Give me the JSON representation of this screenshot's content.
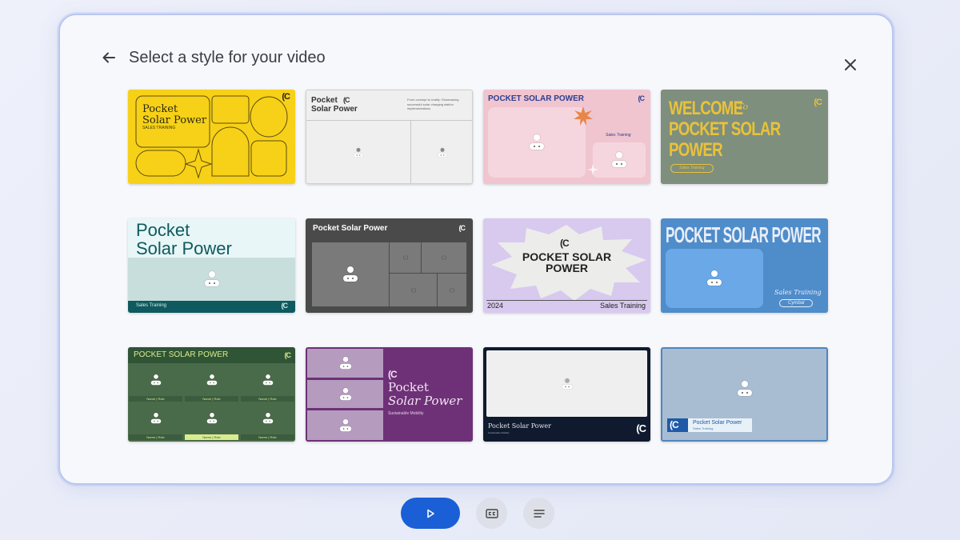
{
  "dialog": {
    "title": "Select a style for your video"
  },
  "logo": "(C",
  "cards": {
    "c1": {
      "title": "Pocket\nSolar Power",
      "subtitle": "SALES TRAINING"
    },
    "c2": {
      "title": "Pocket\nSolar Power",
      "tagline": "From concept to reality: Showcasing successful solar charging station implementations"
    },
    "c3": {
      "title": "POCKET SOLAR POWER",
      "subtitle": "Sales Training"
    },
    "c4": {
      "line1": "WELCOME",
      "to": "To",
      "line2": "POCKET SOLAR",
      "line3": "POWER",
      "subtitle": "Sales Training"
    },
    "c5": {
      "title": "Pocket\nSolar Power",
      "footer": "Sales Training"
    },
    "c6": {
      "title": "Pocket Solar Power"
    },
    "c7": {
      "title": "POCKET SOLAR\nPOWER",
      "year": "2024",
      "footer": "Sales Training"
    },
    "c8": {
      "title": "POCKET SOLAR POWER",
      "subtitle": "Sales Training",
      "badge": "Cymbal"
    },
    "c9": {
      "title": "POCKET SOLAR POWER",
      "name_label": "Name | Role"
    },
    "c10": {
      "line1": "Pocket",
      "line2": "Solar Power",
      "subtitle": "Sustainable Mobility"
    },
    "c11": {
      "title": "Pocket Solar Power",
      "subtitle": "Sustainable Mobility"
    },
    "c12": {
      "title": "Pocket Solar Power",
      "subtitle": "Sales Training"
    }
  },
  "colors": {
    "primary": "#1a5fd6",
    "yellow": "#f7d117",
    "pink": "#f0c5d0",
    "sage": "#7e8f7e",
    "teal": "#0e5a5e",
    "purple": "#6e3177",
    "blue": "#4f8cca"
  },
  "icons": {
    "back": "arrow-left-icon",
    "close": "close-icon",
    "play": "play-icon",
    "captions": "closed-captions-icon",
    "transcript": "transcript-lines-icon"
  }
}
